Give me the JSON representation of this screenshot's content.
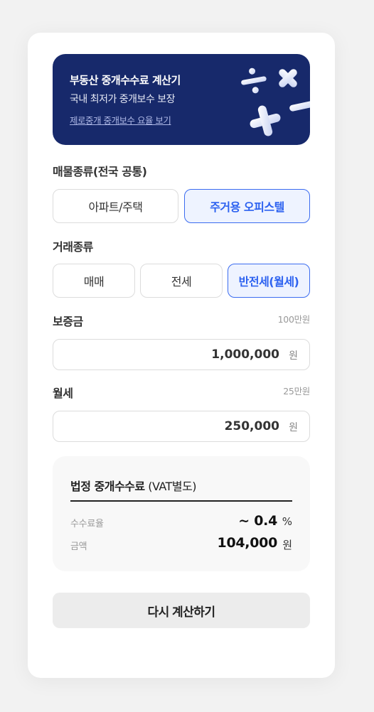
{
  "banner": {
    "title": "부동산 중개수수료 계산기",
    "subtitle": "국내 최저가 중개보수 보장",
    "link": "제로중개 중개보수 요율 보기",
    "bg_color": "#17296b"
  },
  "property_type": {
    "label": "매물종류(전국 공통)",
    "options": [
      {
        "label": "아파트/주택",
        "selected": false
      },
      {
        "label": "주거용 오피스텔",
        "selected": true
      }
    ]
  },
  "transaction_type": {
    "label": "거래종류",
    "options": [
      {
        "label": "매매",
        "selected": false
      },
      {
        "label": "전세",
        "selected": false
      },
      {
        "label": "반전세(월세)",
        "selected": true
      }
    ]
  },
  "deposit": {
    "label": "보증금",
    "hint": "100만원",
    "value": "1,000,000",
    "unit": "원"
  },
  "monthly_rent": {
    "label": "월세",
    "hint": "25만원",
    "value": "250,000",
    "unit": "원"
  },
  "result": {
    "title": "법정 중개수수료",
    "title_suffix": " (VAT별도)",
    "rate_label": "수수료율",
    "rate_value": "~ 0.4",
    "rate_unit": "%",
    "amount_label": "금액",
    "amount_value": "104,000",
    "amount_unit": "원"
  },
  "reset_button": "다시 계산하기",
  "colors": {
    "accent": "#3b6cf0",
    "accent_bg": "#eef3ff",
    "page_bg": "#f2f2f2"
  }
}
